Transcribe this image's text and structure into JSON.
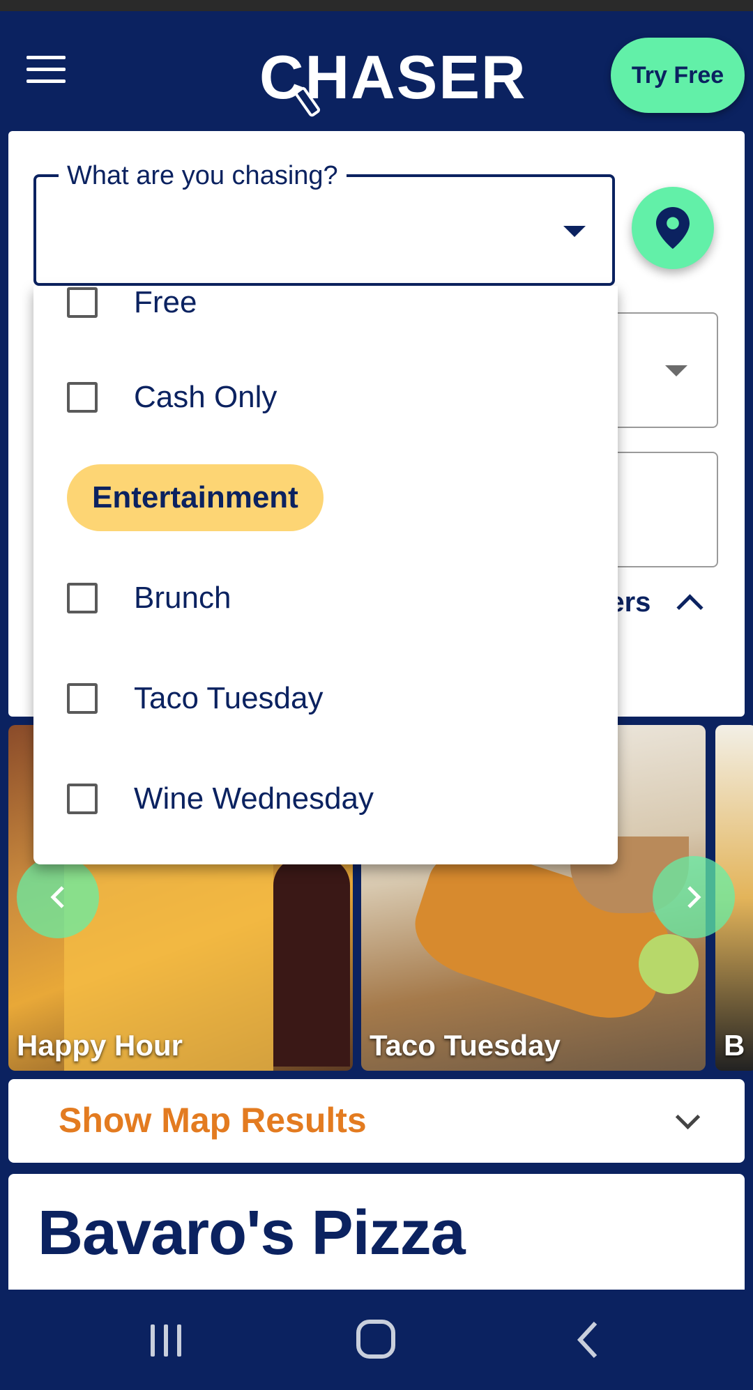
{
  "header": {
    "logo_text": "CHASER",
    "try_free_label": "Try Free"
  },
  "search": {
    "label": "What are you chasing?",
    "filters_partial_label": "ters"
  },
  "dropdown": {
    "items": [
      {
        "type": "checkbox",
        "label": "Free",
        "checked": false
      },
      {
        "type": "checkbox",
        "label": "Cash Only",
        "checked": false
      },
      {
        "type": "group",
        "label": "Entertainment"
      },
      {
        "type": "checkbox",
        "label": "Brunch",
        "checked": false
      },
      {
        "type": "checkbox",
        "label": "Taco Tuesday",
        "checked": false
      },
      {
        "type": "checkbox",
        "label": "Wine Wednesday",
        "checked": false
      }
    ]
  },
  "carousel": {
    "cards": [
      {
        "label": "Happy Hour"
      },
      {
        "label": "Taco Tuesday"
      },
      {
        "label": "B"
      }
    ]
  },
  "map_results": {
    "label": "Show Map Results"
  },
  "result": {
    "title": "Bavaro's Pizza"
  },
  "colors": {
    "brand_navy": "#0b2260",
    "accent_green": "#62f0a8",
    "chip_yellow": "#fdd574",
    "map_orange": "#e37b20"
  }
}
